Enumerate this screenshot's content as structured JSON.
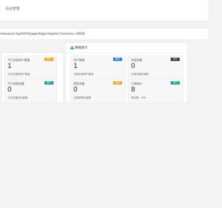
{
  "header": {
    "title": "后台管理"
  },
  "address_bar": {
    "url": "manvaism.top/h5/#/pages/login/register?recomno=10000"
  },
  "stats_panel": {
    "title": "数据统计"
  },
  "cards": {
    "registered_users": {
      "label": "今日注册用户数量",
      "badge": "实时",
      "value": "1",
      "note": "今日注册新用户数量"
    },
    "today_recharge": {
      "label": "今日充值金额",
      "badge": "实时",
      "value": "0",
      "note": "今日充值成功金额"
    },
    "total_users": {
      "label": "用户数量",
      "badge": "实时",
      "value": "1",
      "note": "当前全部用户数量"
    },
    "recharge_amount": {
      "label": "充值金额",
      "badge": "实时",
      "value": "0",
      "note": "当前充值总金额"
    },
    "withdraw_amount": {
      "label": "提现金额",
      "badge": "实时",
      "value": "0",
      "note": "当前提现总金额"
    },
    "order_stats": {
      "label": "订单统计",
      "badge": "实时",
      "value": "8",
      "note": "成功数：408"
    }
  },
  "colors": {
    "orange": "#f6a623",
    "blue": "#1e88e5",
    "dark": "#2f3d4a",
    "teal": "#1aa093"
  }
}
